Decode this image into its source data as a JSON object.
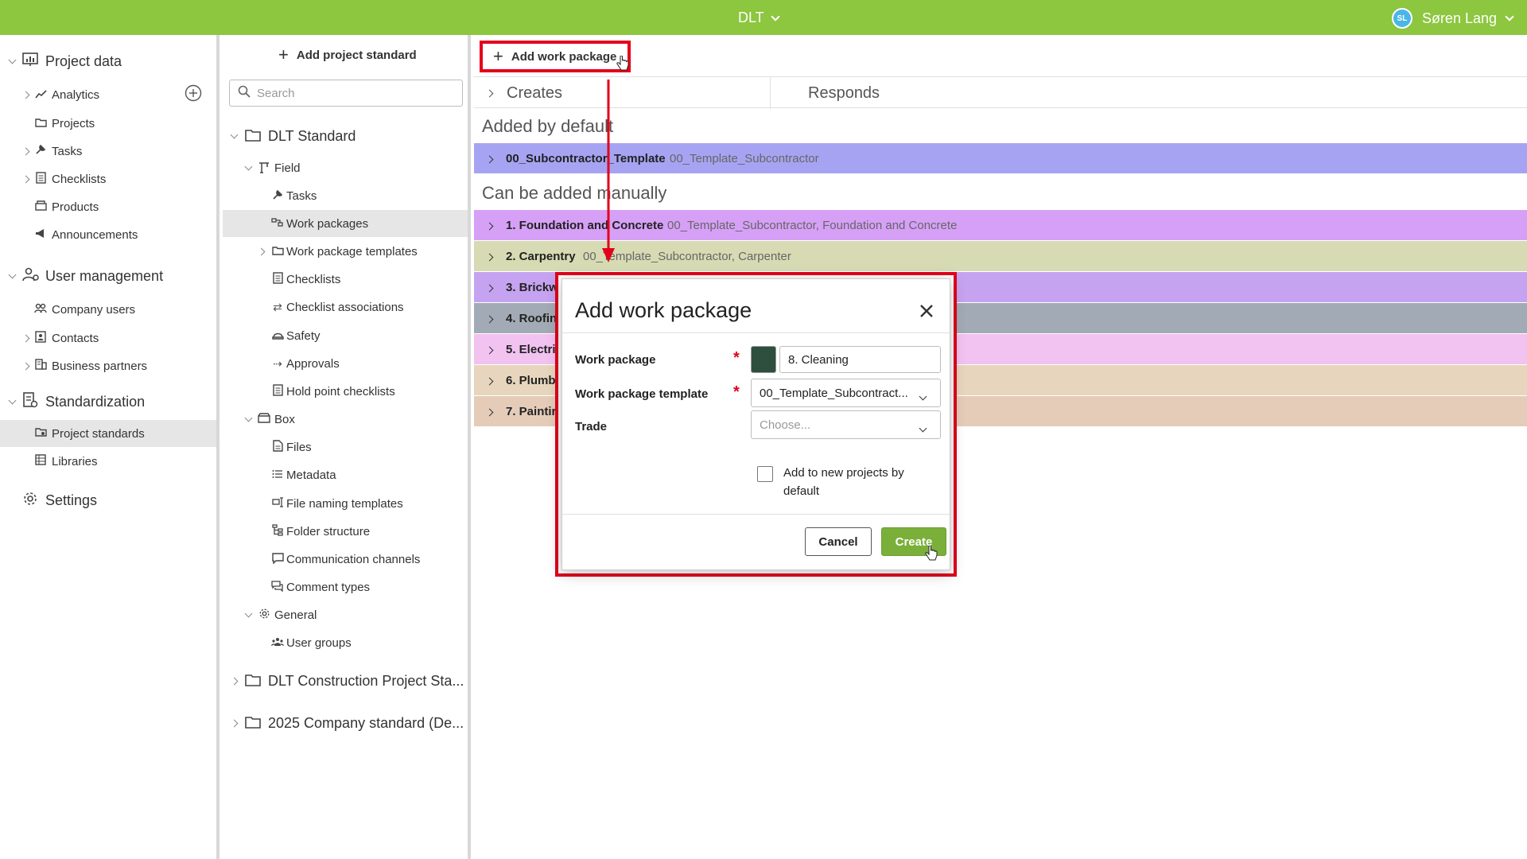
{
  "topbar": {
    "project": "DLT",
    "user_initials": "SL",
    "user_name": "Søren Lang",
    "bg_color": "#8dc63f"
  },
  "leftnav": {
    "sections": [
      {
        "label": "Project data",
        "icon": "chart-board-icon"
      },
      {
        "label": "User management",
        "icon": "users-gear-icon"
      },
      {
        "label": "Standardization",
        "icon": "standard-doc-icon"
      },
      {
        "label": "Settings",
        "icon": "gear-icon"
      }
    ],
    "items": {
      "analytics": "Analytics",
      "projects": "Projects",
      "tasks": "Tasks",
      "checklists": "Checklists",
      "products": "Products",
      "announcements": "Announcements",
      "company_users": "Company users",
      "contacts": "Contacts",
      "business_partners": "Business partners",
      "project_standards": "Project standards",
      "libraries": "Libraries"
    }
  },
  "midtree": {
    "add_label": "Add project standard",
    "search_placeholder": "Search",
    "dlt_standard": "DLT Standard",
    "field": "Field",
    "tasks": "Tasks",
    "work_packages": "Work packages",
    "work_package_templates": "Work package templates",
    "checklists": "Checklists",
    "checklist_associations": "Checklist associations",
    "safety": "Safety",
    "approvals": "Approvals",
    "hold_point_checklists": "Hold point checklists",
    "box": "Box",
    "files": "Files",
    "metadata": "Metadata",
    "file_naming_templates": "File naming templates",
    "folder_structure": "Folder structure",
    "communication_channels": "Communication channels",
    "comment_types": "Comment types",
    "general": "General",
    "user_groups": "User groups",
    "dlt_construction": "DLT Construction Project Sta...",
    "company_2025": "2025 Company standard (De..."
  },
  "main": {
    "add_wp_label": "Add work package",
    "tabs": {
      "creates": "Creates",
      "responds": "Responds"
    },
    "heading_default": "Added by default",
    "heading_manual": "Can be added manually",
    "default_rows": [
      {
        "name": "00_Subcontractor_Template",
        "template": "00_Template_Subcontractor",
        "color": "#a6a4f2"
      }
    ],
    "manual_rows": [
      {
        "name": "1. Foundation and Concrete",
        "template": "00_Template_Subcontractor, Foundation and Concrete",
        "color": "#d6a0f7"
      },
      {
        "name": "2. Carpentry",
        "template": "00_Template_Subcontractor, Carpenter",
        "color": "#d7dbb3"
      },
      {
        "name": "3. Brickw",
        "template": "",
        "color": "#c6a3f0"
      },
      {
        "name": "4. Roofin",
        "template": "",
        "color": "#a2abb5"
      },
      {
        "name": "5. Electri",
        "template": "",
        "color": "#f2c2f0"
      },
      {
        "name": "6. Plumb",
        "template": "",
        "color": "#e7d6bd"
      },
      {
        "name": "7. Paintir",
        "template": "",
        "color": "#e5ccb9"
      }
    ]
  },
  "modal": {
    "title": "Add work package",
    "close_icon": "close-icon",
    "work_package_label": "Work package",
    "work_package_value": "8. Cleaning",
    "swatch_color": "#2e4f3e",
    "template_label": "Work package template",
    "template_value": "00_Template_Subcontract...",
    "trade_label": "Trade",
    "trade_placeholder": "Choose...",
    "checkbox_label": "Add to new projects by default",
    "checkbox_checked": false,
    "cancel_label": "Cancel",
    "create_label": "Create"
  },
  "annotation_color": "#e3001b"
}
